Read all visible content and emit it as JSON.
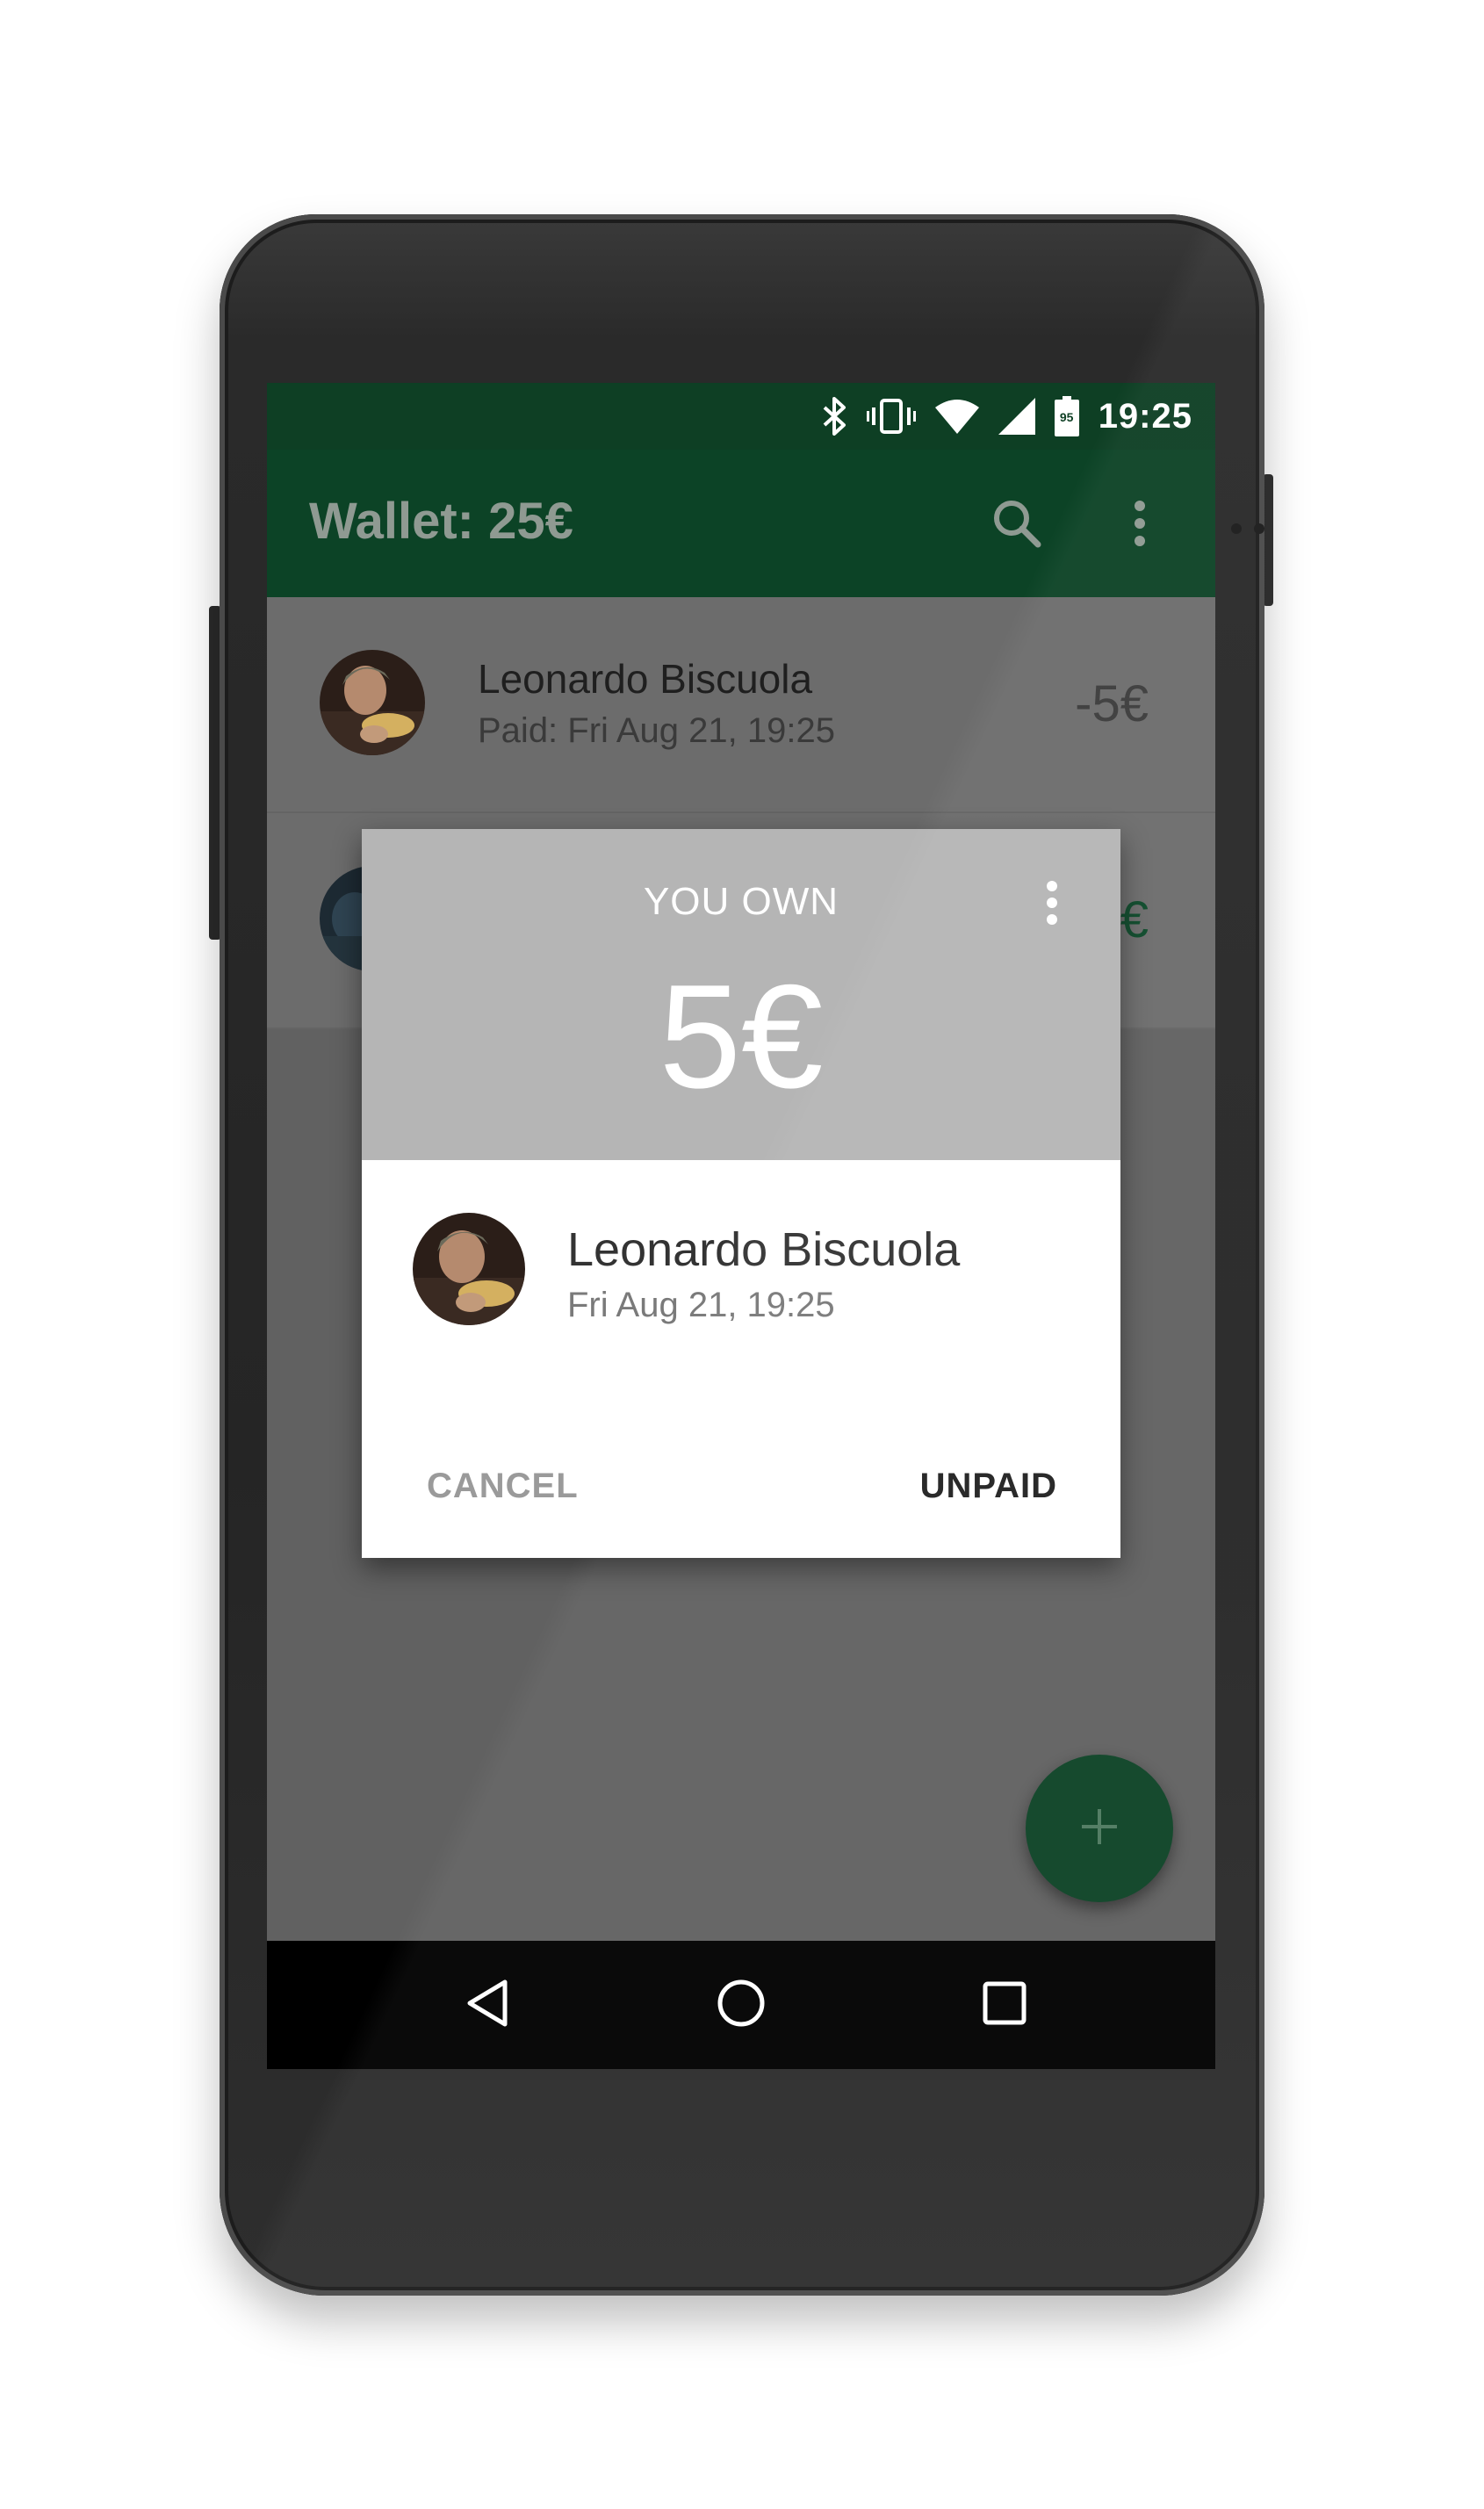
{
  "status_bar": {
    "time": "19:25",
    "battery_level": "95",
    "icons": [
      "bluetooth-icon",
      "vibrate-icon",
      "wifi-icon",
      "cell-signal-icon",
      "battery-icon"
    ]
  },
  "app_bar": {
    "title": "Wallet: 25€",
    "actions": [
      "search-icon",
      "more-vert-icon"
    ]
  },
  "list": {
    "items": [
      {
        "name": "Leonardo Biscuola",
        "subtitle": "Paid: Fri Aug 21, 19:25",
        "amount": "-5€"
      },
      {
        "name": "",
        "subtitle": "",
        "amount": "€"
      }
    ]
  },
  "dialog": {
    "title": "YOU OWN",
    "amount": "5€",
    "person_name": "Leonardo Biscuola",
    "date": "Fri Aug 21, 19:25",
    "cancel_label": "CANCEL",
    "unpaid_label": "UNPAID"
  },
  "fab": {
    "icon": "plus-icon"
  },
  "nav_bar": {
    "icons": [
      "back-icon",
      "home-icon",
      "recents-icon"
    ]
  },
  "colors": {
    "primary": "#0c4326",
    "status_bar": "#0e3f24",
    "dialog_header": "#b5b5b5",
    "scrim_background": "#616161"
  }
}
